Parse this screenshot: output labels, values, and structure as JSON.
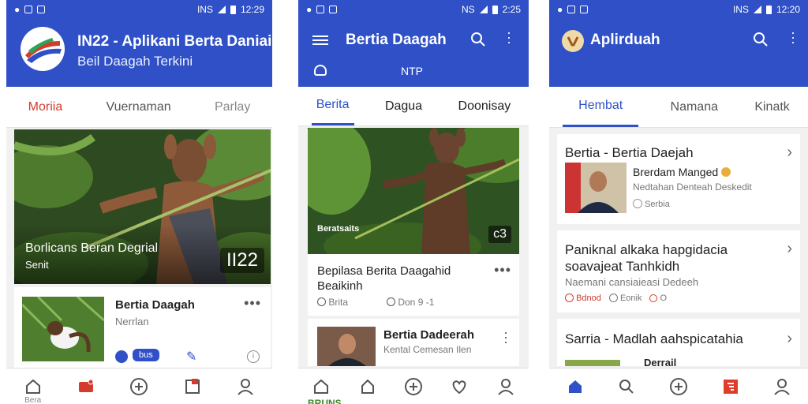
{
  "phone1": {
    "status": {
      "time": "12:29",
      "carrier": "INS"
    },
    "header": {
      "title": "IN22 - Aplikani Berta Daniai",
      "subtitle": "Beil Daagah Terkini"
    },
    "tabs": [
      {
        "label": "Moriia",
        "active": true
      },
      {
        "label": "Vuernaman",
        "active": false
      },
      {
        "label": "Parlay",
        "active": false
      }
    ],
    "hero": {
      "caption_title": "Borlicans Beran Degrial",
      "caption_sub": "Senit",
      "badge": "II22"
    },
    "story": {
      "title": "Bertia Daagah",
      "subtitle": "Nerrlan",
      "tag": "bus"
    },
    "nav": [
      {
        "icon": "home-icon",
        "label": "Bera"
      },
      {
        "icon": "inbox-icon",
        "label": ""
      },
      {
        "icon": "add-icon",
        "label": ""
      },
      {
        "icon": "bookmark-icon",
        "label": ""
      },
      {
        "icon": "profile-icon",
        "label": ""
      }
    ]
  },
  "phone2": {
    "status": {
      "time": "2:25",
      "carrier": "NS"
    },
    "header": {
      "title": "Bertia Daagah",
      "sub_label": "NTP"
    },
    "tabs": [
      {
        "label": "Berita",
        "active": true
      },
      {
        "label": "Dagua",
        "active": false
      },
      {
        "label": "Doonisay",
        "active": false
      }
    ],
    "hero": {
      "caption": "Beratsaits",
      "badge": "c3"
    },
    "article": {
      "title": "Bepilasa Berita Daagahid Beaikinh",
      "meta": [
        {
          "icon": "clock-icon",
          "text": "Brita"
        },
        {
          "icon": "clock-icon",
          "text": "Don 9 -1"
        }
      ]
    },
    "story": {
      "title": "Bertia Dadeerah",
      "subtitle": "Kental Cemesan Ilen"
    },
    "bottom_peek": "BRUNS"
  },
  "phone3": {
    "status": {
      "time": "12:20",
      "carrier": "INS"
    },
    "header": {
      "title": "Aplirduah"
    },
    "tabs": [
      {
        "label": "Hembat",
        "active": true
      },
      {
        "label": "Namana",
        "active": false
      },
      {
        "label": "Kinatk",
        "active": false
      }
    ],
    "cards": [
      {
        "title": "Bertia - Bertia Daejah",
        "name": "Brerdam Manged",
        "desc": "Nedtahan Denteah Deskedit",
        "tag": "Serbia"
      },
      {
        "title": "Paniknal alkaka hapgidacia soavajeat Tanhkidh",
        "desc": "Naemani cansiaieasi Dedeeh",
        "meta": [
          {
            "text": "Bdnod"
          },
          {
            "text": "Eonik"
          },
          {
            "text": "O"
          }
        ]
      },
      {
        "title": "Sarria - Madlah aahspicatahia",
        "peek": "Derrail"
      }
    ]
  }
}
